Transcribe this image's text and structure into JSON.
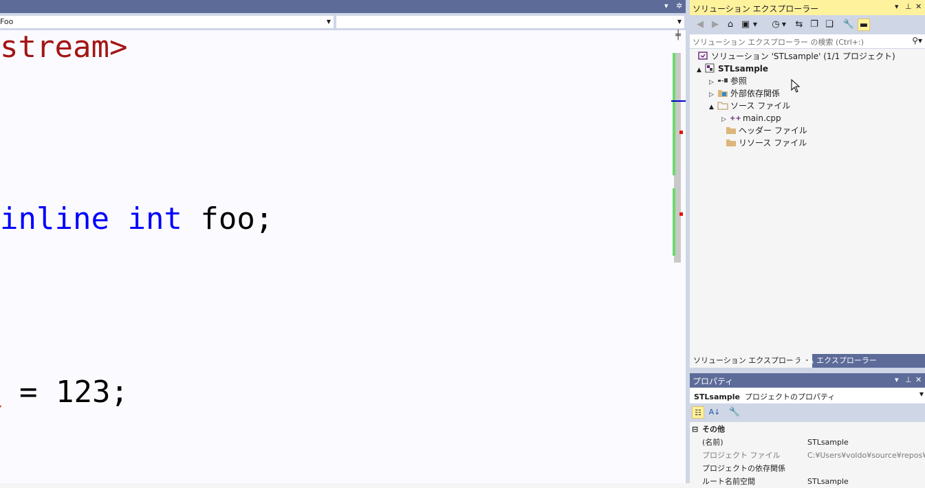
{
  "editor": {
    "nav": {
      "scope_value": "Foo",
      "member_value": ""
    },
    "code_lines": [
      {
        "parts": [
          {
            "text": "stream>",
            "cls": "str"
          }
        ]
      },
      {
        "parts": [
          {
            "text": "inline",
            "cls": "kw"
          },
          {
            "text": " ",
            "cls": "txt"
          },
          {
            "text": "int",
            "cls": "kw"
          },
          {
            "text": " foo;",
            "cls": "txt"
          }
        ]
      },
      {
        "parts": [
          {
            "text": "o",
            "cls": "txt squiggle"
          },
          {
            "text": " = 123;",
            "cls": "txt"
          }
        ]
      }
    ]
  },
  "solution_explorer": {
    "title": "ソリューション エクスプローラー",
    "search_placeholder": "ソリューション エクスプローラー の検索 (Ctrl+:)",
    "tree": [
      {
        "label": "ソリューション 'STLsample' (1/1 プロジェクト)",
        "icon": "solution-icon",
        "expander": "",
        "bold": false
      },
      {
        "label": "STLsample",
        "icon": "project-icon",
        "expander": "▲",
        "bold": true
      },
      {
        "label": "参照",
        "icon": "references-icon",
        "expander": "▷",
        "bold": false
      },
      {
        "label": "外部依存関係",
        "icon": "external-deps-icon",
        "expander": "▷",
        "bold": false
      },
      {
        "label": "ソース ファイル",
        "icon": "folder-icon",
        "expander": "▲",
        "bold": false
      },
      {
        "label": "main.cpp",
        "icon": "cpp-file-icon",
        "expander": "▷",
        "bold": false
      },
      {
        "label": "ヘッダー ファイル",
        "icon": "folder-icon",
        "expander": "",
        "bold": false
      },
      {
        "label": "リソース ファイル",
        "icon": "folder-icon",
        "expander": "",
        "bold": false
      }
    ],
    "tabs": [
      "ソリューション エクスプローラー",
      "チーム エクスプローラー"
    ]
  },
  "properties": {
    "title": "プロパティ",
    "object_name": "STLsample",
    "object_type": "プロジェクトのプロパティ",
    "category": "その他",
    "rows": [
      {
        "name": "(名前)",
        "value": "STLsample",
        "dim": false
      },
      {
        "name": "プロジェクト ファイル",
        "value": "C:¥Users¥voldo¥source¥repos¥ST",
        "dim": true
      },
      {
        "name": "プロジェクトの依存関係",
        "value": "",
        "dim": false
      },
      {
        "name": "ルート名前空間",
        "value": "STLsample",
        "dim": false
      }
    ]
  },
  "colors": {
    "accent": "#5d6b99",
    "active_header": "#fff29d",
    "keyword": "#0000ff",
    "string": "#a31515",
    "error": "#e51400",
    "change_bar": "#6bd96b"
  }
}
